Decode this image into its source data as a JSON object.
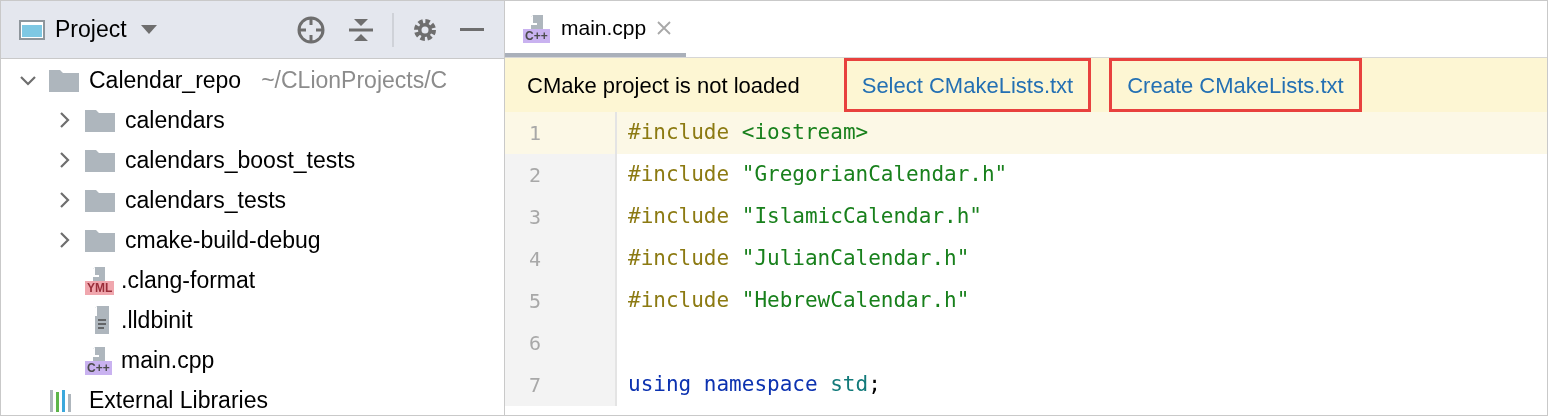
{
  "project_panel": {
    "title": "Project",
    "tree": [
      {
        "label": "Calendar_repo",
        "kind": "folder",
        "expanded": true,
        "path": "~/CLionProjects/C",
        "children": [
          {
            "label": "calendars",
            "kind": "folder",
            "expanded": false
          },
          {
            "label": "calendars_boost_tests",
            "kind": "folder",
            "expanded": false
          },
          {
            "label": "calendars_tests",
            "kind": "folder",
            "expanded": false
          },
          {
            "label": "cmake-build-debug",
            "kind": "folder",
            "expanded": false
          },
          {
            "label": ".clang-format",
            "kind": "yml",
            "badge": "YML"
          },
          {
            "label": ".lldbinit",
            "kind": "text"
          },
          {
            "label": "main.cpp",
            "kind": "cpp",
            "badge": "C++"
          }
        ]
      },
      {
        "label": "External Libraries",
        "kind": "libraries"
      }
    ]
  },
  "editor": {
    "tabs": [
      {
        "label": "main.cpp",
        "badge": "C++",
        "selected": true
      }
    ],
    "banner": {
      "message": "CMake project is not loaded",
      "links": [
        {
          "label": "Select CMakeLists.txt",
          "highlighted": true
        },
        {
          "label": "Create CMakeLists.txt",
          "highlighted": true
        }
      ]
    },
    "lines": [
      {
        "number": "1",
        "current": true,
        "tokens": [
          {
            "kind": "directive",
            "text": "#include"
          },
          {
            "kind": "string",
            "text": "<iostream>"
          }
        ]
      },
      {
        "number": "2",
        "current": false,
        "tokens": [
          {
            "kind": "directive",
            "text": "#include"
          },
          {
            "kind": "string",
            "text": "\"GregorianCalendar.h\""
          }
        ]
      },
      {
        "number": "3",
        "current": false,
        "tokens": [
          {
            "kind": "directive",
            "text": "#include"
          },
          {
            "kind": "string",
            "text": "\"IslamicCalendar.h\""
          }
        ]
      },
      {
        "number": "4",
        "current": false,
        "tokens": [
          {
            "kind": "directive",
            "text": "#include"
          },
          {
            "kind": "string",
            "text": "\"JulianCalendar.h\""
          }
        ]
      },
      {
        "number": "5",
        "current": false,
        "tokens": [
          {
            "kind": "directive",
            "text": "#include"
          },
          {
            "kind": "string",
            "text": "\"HebrewCalendar.h\""
          }
        ]
      },
      {
        "number": "6",
        "current": false
      },
      {
        "number": "7",
        "current": false,
        "tokens": [
          {
            "kind": "keyword",
            "text": "using"
          },
          {
            "kind": "keyword",
            "text": "namespace"
          },
          {
            "kind": "namespace",
            "text": "std"
          },
          {
            "kind": "plain",
            "text": ";"
          }
        ]
      }
    ]
  }
}
